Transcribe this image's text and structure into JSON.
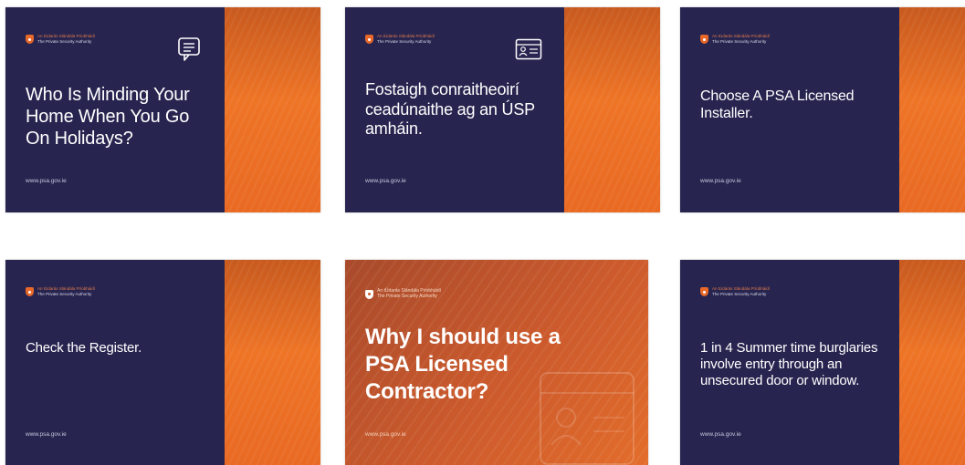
{
  "brand": {
    "name_irish": "An tÚdarás Slándála Príobháidí",
    "name_english": "The Private Security Authority"
  },
  "colors": {
    "navy": "#27244f",
    "orange": "#ee7426",
    "white": "#ffffff"
  },
  "cards": [
    {
      "headline": "Who Is Minding Your Home When You Go On Holidays?",
      "url": "www.psa.gov.ie",
      "icon": "chat-bubble-icon"
    },
    {
      "headline": "Fostaigh conraitheoirí ceadúnaithe ag an ÚSP amháin.",
      "url": "www.psa.gov.ie",
      "icon": "id-card-icon"
    },
    {
      "headline": "Choose A PSA Licensed Installer.",
      "url": "www.psa.gov.ie"
    },
    {
      "headline": "Check the Register.",
      "url": "www.psa.gov.ie"
    },
    {
      "headline": "Why I should use a PSA Licensed Contractor?",
      "url": "www.psa.gov.ie",
      "icon": "id-card-icon"
    },
    {
      "headline": "1 in 4 Summer time burglaries involve entry through an unsecured door or window.",
      "url": "www.psa.gov.ie"
    }
  ]
}
